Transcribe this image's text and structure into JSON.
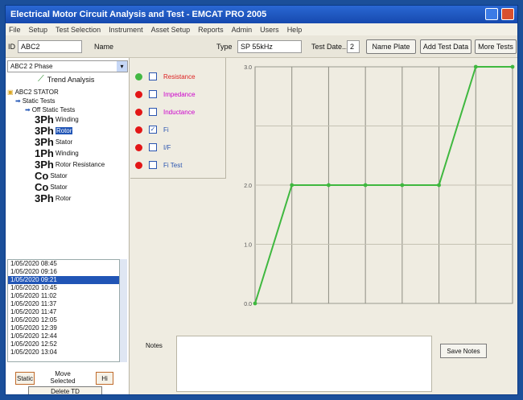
{
  "window": {
    "title": "Electrical Motor Circuit Analysis and Test - EMCAT PRO 2005"
  },
  "menu": [
    "File",
    "Setup",
    "Test Selection",
    "Instrument",
    "Asset Setup",
    "Reports",
    "Admin",
    "Users",
    "Help"
  ],
  "toolbar": {
    "id_label": "ID",
    "id_value": "ABC2",
    "name_label": "Name",
    "type_label": "Type",
    "type_value": "SP 55kHz",
    "test_date_label": "Test Date...",
    "test_date_value": "2",
    "buttons": [
      "Name Plate",
      "Add Test Data",
      "More Tests"
    ]
  },
  "left": {
    "combo_value": "ABC2 2 Phase",
    "trend_label": "Trend Analysis",
    "tree": [
      {
        "label": "ABC2 STATOR",
        "indent": 0
      },
      {
        "label": "Static Tests",
        "indent": 1
      },
      {
        "label": "Off Static Tests",
        "indent": 2
      },
      {
        "prefix": "3Ph",
        "label": "Winding",
        "indent": 3
      },
      {
        "prefix": "3Ph",
        "label": "Rotor",
        "indent": 3,
        "selected": true
      },
      {
        "prefix": "3Ph",
        "label": "Stator",
        "indent": 3
      },
      {
        "prefix": "1Ph",
        "label": "Winding",
        "indent": 3
      },
      {
        "prefix": "3Ph",
        "label": "Rotor Resistance",
        "indent": 3
      },
      {
        "prefix": "Co",
        "label": "Stator",
        "indent": 3
      },
      {
        "prefix": "Co",
        "label": "Stator",
        "indent": 3
      },
      {
        "prefix": "3Ph",
        "label": "Rotor",
        "indent": 3
      }
    ],
    "list": [
      "1/05/2020 08:45",
      "1/05/2020 09:16",
      "1/05/2020 09:21",
      "1/05/2020 10:45",
      "1/05/2020 11:02",
      "1/05/2020 11:37",
      "1/05/2020 11:47",
      "1/05/2020 12:05",
      "1/05/2020 12:39",
      "1/05/2020 12:44",
      "1/05/2020 12:52",
      "1/05/2020 13:04"
    ],
    "list_selected": 2,
    "buttons": {
      "left": "Static",
      "middle": "Move Selected",
      "right": "Hi",
      "bottom": "Delete TD"
    }
  },
  "legend": [
    {
      "label": "Resistance",
      "color": "#43b843",
      "checked": false,
      "text_color": "#d22"
    },
    {
      "label": "Impedance",
      "color": "#e31616",
      "checked": false,
      "text_color": "#c0c"
    },
    {
      "label": "Inductance",
      "color": "#e31616",
      "checked": false,
      "text_color": "#c0c"
    },
    {
      "label": "Fi",
      "color": "#e31616",
      "checked": true,
      "text_color": "#2a55b0"
    },
    {
      "label": "I/F",
      "color": "#e31616",
      "checked": false,
      "text_color": "#2a55b0"
    },
    {
      "label": "Fi Test",
      "color": "#e31616",
      "checked": false,
      "text_color": "#2a55b0"
    }
  ],
  "chart_data": {
    "type": "line",
    "x": [
      0,
      1,
      2,
      3,
      4,
      5,
      6,
      7
    ],
    "series": [
      {
        "values": [
          0,
          2,
          2,
          2,
          2,
          2,
          4,
          4
        ],
        "color": "#3fb83f"
      }
    ],
    "ylim": [
      0,
      4
    ],
    "yticks": [
      "0.0",
      "1.0",
      "2.0",
      "3.0"
    ],
    "grid": true
  },
  "notes": {
    "label": "Notes",
    "button": "Save Notes"
  },
  "colors": {
    "accent": "#2155b6",
    "line": "#3fb83f"
  }
}
